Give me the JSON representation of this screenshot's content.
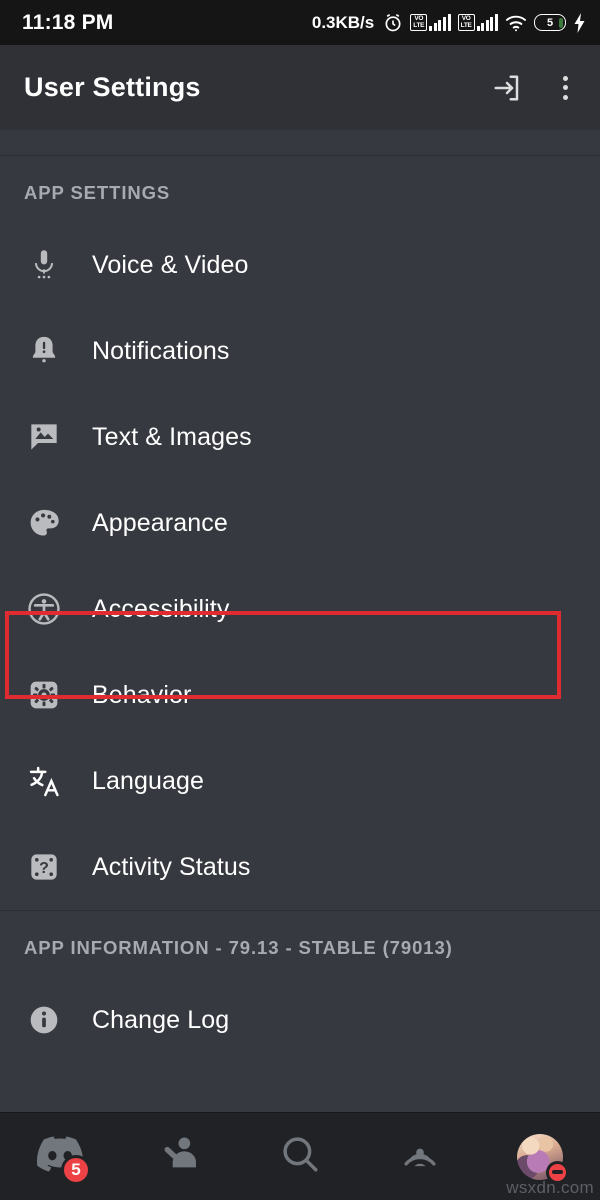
{
  "status_bar": {
    "clock": "11:18 PM",
    "network_rate": "0.3KB/s",
    "alarm_icon": "alarm-clock-icon",
    "sim1": {
      "label_top": "VO",
      "label_bottom": "LTE",
      "bars": 4
    },
    "sim2": {
      "label_top": "VO",
      "label_bottom": "LTE",
      "bars": 4
    },
    "wifi_icon": "wifi-icon",
    "battery_level": "5",
    "charging_icon": "lightning-bolt-icon"
  },
  "app_bar": {
    "title": "User Settings",
    "logout_icon": "logout-icon",
    "overflow_icon": "kebab-menu-icon"
  },
  "sections": [
    {
      "header": "APP SETTINGS",
      "items": [
        {
          "label": "Voice & Video",
          "icon": "microphone-icon",
          "highlighted": false
        },
        {
          "label": "Notifications",
          "icon": "bell-alert-icon",
          "highlighted": false
        },
        {
          "label": "Text & Images",
          "icon": "chat-image-icon",
          "highlighted": false
        },
        {
          "label": "Appearance",
          "icon": "palette-icon",
          "highlighted": false
        },
        {
          "label": "Accessibility",
          "icon": "accessibility-icon",
          "highlighted": false
        },
        {
          "label": "Behavior",
          "icon": "gear-square-icon",
          "highlighted": true
        },
        {
          "label": "Language",
          "icon": "translate-icon",
          "highlighted": false
        },
        {
          "label": "Activity Status",
          "icon": "game-activity-icon",
          "highlighted": false
        }
      ]
    },
    {
      "header": "APP INFORMATION - 79.13 - STABLE (79013)",
      "items": [
        {
          "label": "Change Log",
          "icon": "info-circle-icon",
          "highlighted": false
        }
      ]
    }
  ],
  "bottom_nav": [
    {
      "name": "servers",
      "icon": "discord-clyde-icon",
      "badge": "5"
    },
    {
      "name": "friends",
      "icon": "friends-icon",
      "badge": ""
    },
    {
      "name": "search",
      "icon": "search-icon",
      "badge": ""
    },
    {
      "name": "mentions",
      "icon": "mentions-icon",
      "badge": ""
    },
    {
      "name": "profile",
      "icon": "user-avatar",
      "badge": ""
    }
  ],
  "annotation": {
    "target_label": "Behavior",
    "box_color": "#e02b30"
  },
  "watermark": "wsxdn.com"
}
